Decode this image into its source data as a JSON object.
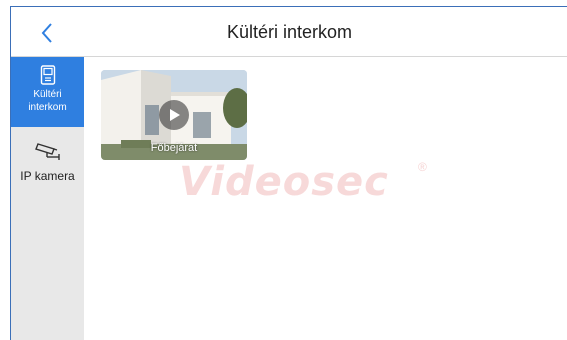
{
  "header": {
    "title": "Kültéri interkom",
    "back_icon": "chevron-left-icon"
  },
  "sidebar": {
    "items": [
      {
        "label": "Kültéri\ninterkom",
        "icon": "intercom-panel-icon",
        "active": true
      },
      {
        "label": "IP kamera",
        "icon": "cctv-camera-icon",
        "active": false
      }
    ]
  },
  "main": {
    "tiles": [
      {
        "label": "Főbejárat",
        "icon": "play-icon"
      }
    ]
  },
  "watermark": {
    "text": "Videosec",
    "reg": "®"
  },
  "colors": {
    "accent": "#2f7fe0",
    "sidebar_bg": "#e8e8e8",
    "frame_border": "#3b6fb8"
  }
}
